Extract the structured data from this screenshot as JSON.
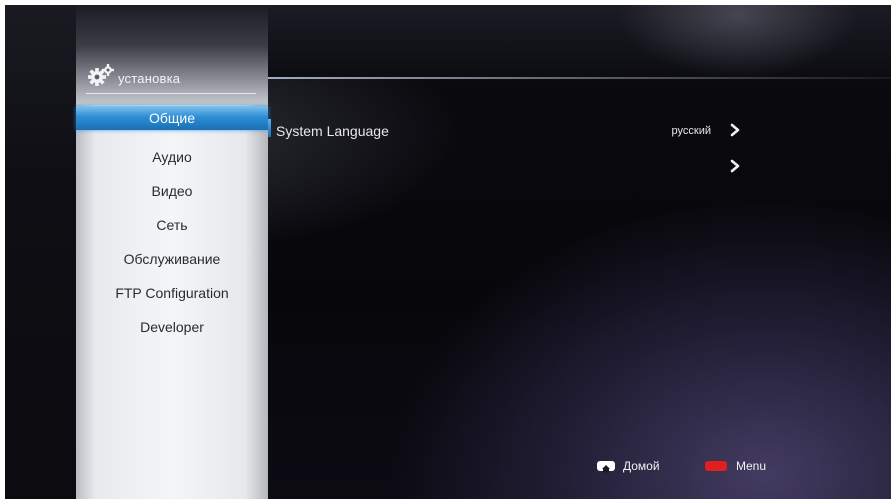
{
  "sidebar": {
    "title": "установка",
    "items": [
      {
        "label": "Общие",
        "selected": true
      },
      {
        "label": "Аудио",
        "selected": false
      },
      {
        "label": "Видео",
        "selected": false
      },
      {
        "label": "Сеть",
        "selected": false
      },
      {
        "label": "Обслуживание",
        "selected": false
      },
      {
        "label": "FTP Configuration",
        "selected": false
      },
      {
        "label": "Developer",
        "selected": false
      }
    ],
    "icon": "gear-icon"
  },
  "content": {
    "rows": [
      {
        "label": "System Language",
        "value": "русский"
      },
      {
        "label": "",
        "value": ""
      }
    ]
  },
  "footer": {
    "home": {
      "label": "Домой",
      "key_color": "#ffffff",
      "icon": "home-icon"
    },
    "menu": {
      "label": "Menu",
      "key_color": "#e0201e"
    }
  },
  "colors": {
    "accent": "#2e8fd4",
    "background": "#0b0b10",
    "sidebar": "#f4f5f7"
  }
}
